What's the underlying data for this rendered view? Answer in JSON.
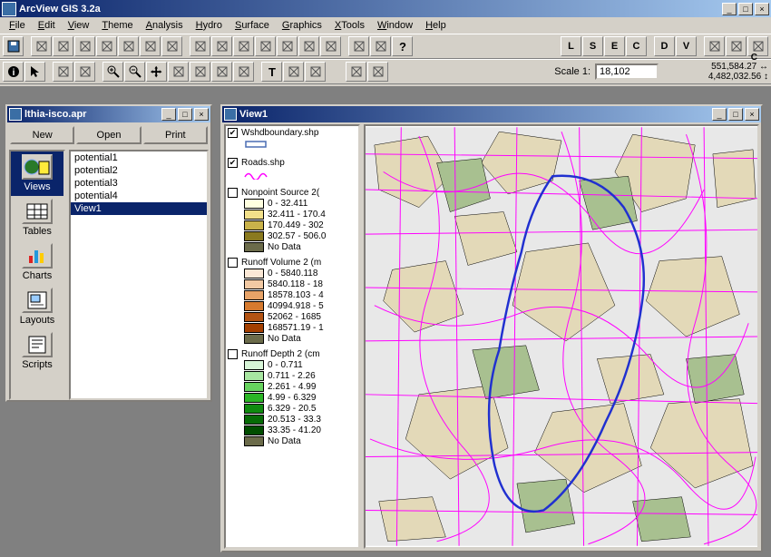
{
  "app": {
    "title": "ArcView GIS 3.2a",
    "titlebar_buttons": {
      "min": "_",
      "max": "□",
      "close": "×"
    }
  },
  "menu": [
    "File",
    "Edit",
    "View",
    "Theme",
    "Analysis",
    "Hydro",
    "Surface",
    "Graphics",
    "XTools",
    "Window",
    "Help"
  ],
  "toolbar_icons": [
    "save-icon",
    "sheet-icon",
    "grid-icon",
    "table-icon",
    "chart-icon",
    "layout-icon",
    "dotplot-icon",
    "brush-icon",
    "find-icon",
    "lens-icon",
    "query-icon",
    "zoomfull-icon",
    "zoomsel-icon",
    "select-icon",
    "clear-icon",
    "logo-icon",
    "refresh-icon",
    "help-icon"
  ],
  "letter_buttons": [
    "L",
    "S",
    "E",
    "C",
    "D",
    "V"
  ],
  "toolbar2_icons": [
    "info-icon",
    "pointer-icon",
    "crosshair-icon",
    "cross-icon",
    "zoomin-icon",
    "zoomout-icon",
    "pan-icon",
    "measure-icon",
    "identify-icon",
    "hotlink-icon",
    "label-icon",
    "text-icon",
    "draw-icon",
    "point-icon"
  ],
  "toolbar2_extra": [
    "tool-a-icon",
    "tool-b-icon"
  ],
  "scale": {
    "label": "Scale 1:",
    "value": "18,102"
  },
  "coords": {
    "top": "551,584.27",
    "bottom": "4,482,032.56",
    "arrow1": "↔",
    "arrow2": "↕",
    "c": "C"
  },
  "project": {
    "title": "lthia-isco.apr",
    "buttons": {
      "new": "New",
      "open": "Open",
      "print": "Print"
    },
    "sidebar": [
      {
        "label": "Views",
        "icon": "views-icon",
        "selected": true
      },
      {
        "label": "Tables",
        "icon": "tables-icon",
        "selected": false
      },
      {
        "label": "Charts",
        "icon": "charts-icon",
        "selected": false
      },
      {
        "label": "Layouts",
        "icon": "layouts-icon",
        "selected": false
      },
      {
        "label": "Scripts",
        "icon": "scripts-icon",
        "selected": false
      }
    ],
    "list": [
      {
        "label": "potential1",
        "selected": false
      },
      {
        "label": "potential2",
        "selected": false
      },
      {
        "label": "potential3",
        "selected": false
      },
      {
        "label": "potential4",
        "selected": false
      },
      {
        "label": "View1",
        "selected": true
      }
    ]
  },
  "view": {
    "title": "View1",
    "layers": [
      {
        "name": "Wshdboundary.shp",
        "checked": true,
        "type": "line",
        "items": [
          {
            "label": "",
            "color": "#4a6db3",
            "line": true
          }
        ]
      },
      {
        "name": "Roads.shp",
        "checked": true,
        "type": "line",
        "items": [
          {
            "label": "",
            "color": "#ff00ff",
            "line": true,
            "squiggle": true
          }
        ]
      },
      {
        "name": "Nonpoint Source 2(",
        "checked": false,
        "type": "poly",
        "items": [
          {
            "label": "0 - 32.411",
            "color": "#ffffe0"
          },
          {
            "label": "32.411 - 170.4",
            "color": "#f2e08a"
          },
          {
            "label": "170.449 - 302",
            "color": "#c9b24a"
          },
          {
            "label": "302.57 - 506.0",
            "color": "#8a7a1f"
          },
          {
            "label": "No Data",
            "color": "#6b6b4a"
          }
        ]
      },
      {
        "name": "Runoff Volume 2 (m",
        "checked": false,
        "type": "poly",
        "items": [
          {
            "label": "0 - 5840.118",
            "color": "#fbe8d6"
          },
          {
            "label": "5840.118 - 18",
            "color": "#f2c9a3"
          },
          {
            "label": "18578.103 - 4",
            "color": "#e7a368"
          },
          {
            "label": "40994.918 - 5",
            "color": "#d67a2f"
          },
          {
            "label": "52062 - 1685",
            "color": "#b35312"
          },
          {
            "label": "168571.19 - 1",
            "color": "#a33f00"
          },
          {
            "label": "No Data",
            "color": "#6b6b4a"
          }
        ]
      },
      {
        "name": "Runoff Depth 2 (cm",
        "checked": false,
        "type": "poly",
        "items": [
          {
            "label": "0 - 0.711",
            "color": "#d7f5d7"
          },
          {
            "label": "0.711 - 2.26",
            "color": "#a8e6a1"
          },
          {
            "label": "2.261 - 4.99",
            "color": "#67d35f"
          },
          {
            "label": "4.99 - 6.329",
            "color": "#2bb526"
          },
          {
            "label": "6.329 - 20.5",
            "color": "#0f8a0f"
          },
          {
            "label": "20.513 - 33.3",
            "color": "#066b06"
          },
          {
            "label": "33.35 - 41.20",
            "color": "#004d00"
          },
          {
            "label": "No Data",
            "color": "#6b6b4a"
          }
        ]
      }
    ]
  }
}
